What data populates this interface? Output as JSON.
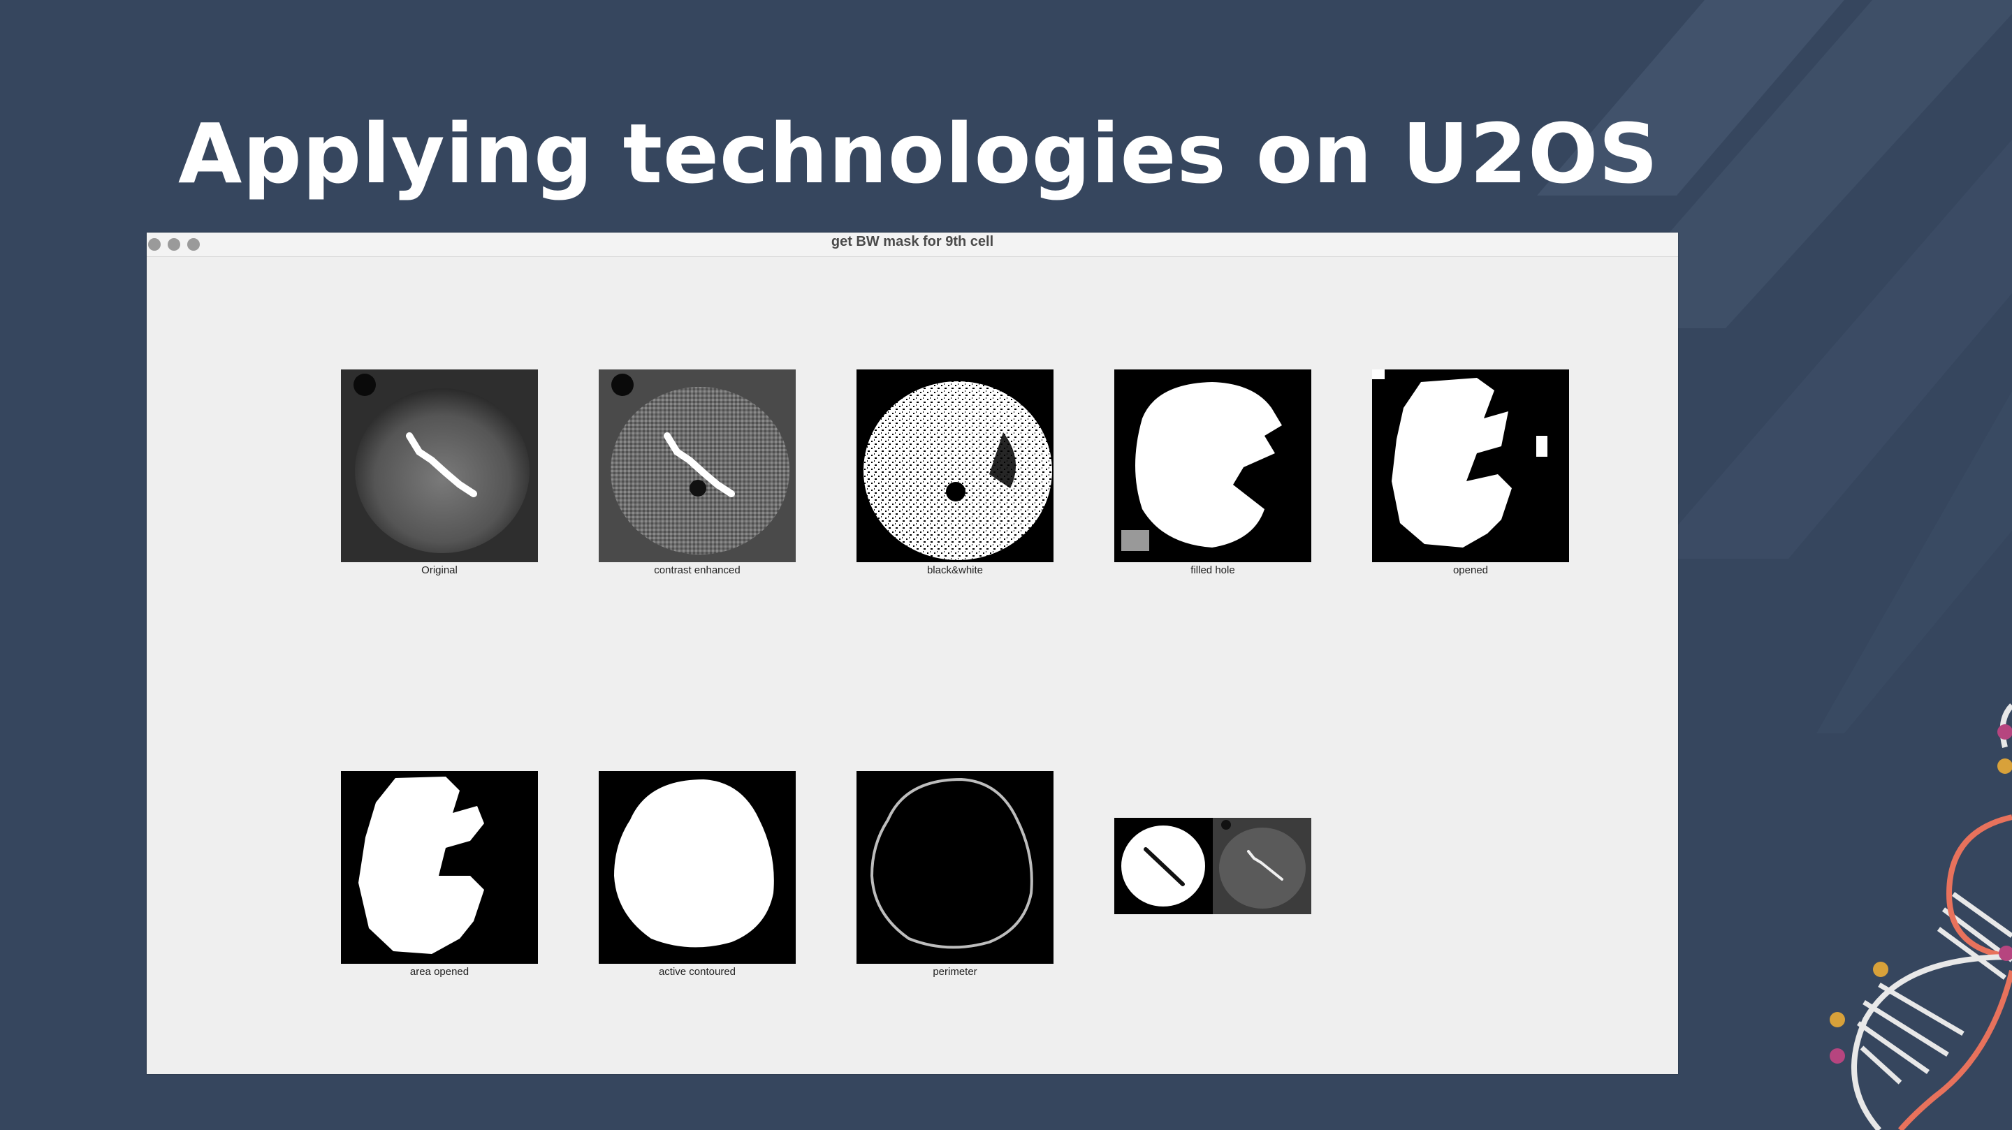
{
  "slide": {
    "title": "Applying technologies on U2OS",
    "background_color": "#36465e",
    "accent_colors": [
      "#e8725c",
      "#d8a13a",
      "#b6457f"
    ]
  },
  "window": {
    "title": "get BW mask for 9th cell",
    "panels": [
      {
        "caption": "Original",
        "icon": "grayscale-cell-image"
      },
      {
        "caption": "contrast enhanced",
        "icon": "contrast-cell-image"
      },
      {
        "caption": "black&white",
        "icon": "binary-noise-mask"
      },
      {
        "caption": "filled hole",
        "icon": "filled-mask"
      },
      {
        "caption": "opened",
        "icon": "opened-mask"
      },
      {
        "caption": "area opened",
        "icon": "area-opened-mask"
      },
      {
        "caption": "active contoured",
        "icon": "contoured-mask"
      },
      {
        "caption": "perimeter",
        "icon": "perimeter-outline"
      }
    ],
    "overlay_icon": "mask-overlay-pair"
  }
}
